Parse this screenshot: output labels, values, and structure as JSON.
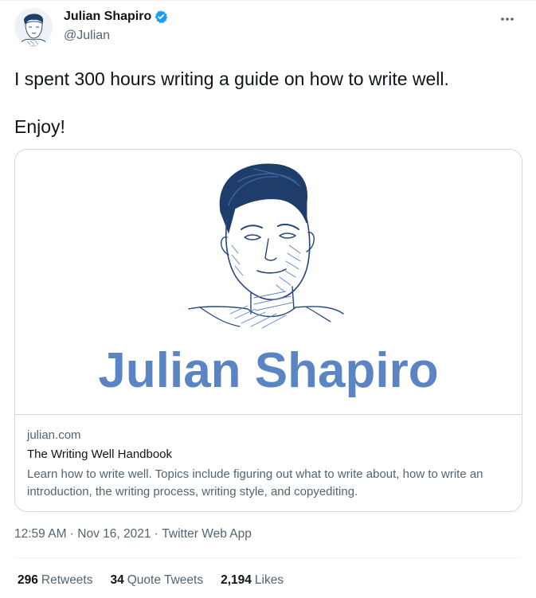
{
  "author": {
    "name": "Julian Shapiro",
    "handle": "@Julian",
    "verified_color": "#1d9bf0",
    "avatar_icon": "person-sketch-avatar"
  },
  "tweet": {
    "lines": [
      "I spent 300 hours writing a guide on how to write well.",
      "Enjoy!"
    ]
  },
  "card": {
    "image_text": "Julian Shapiro",
    "image_text_color": "#5b84c4",
    "domain": "julian.com",
    "title": "The Writing Well Handbook",
    "description": "Learn how to write well. Topics include figuring out what to write about, how to write an introduction, the writing process, writing style, and copyediting."
  },
  "meta": {
    "time": "12:59 AM",
    "date": "Nov 16, 2021",
    "source": "Twitter Web App"
  },
  "stats": {
    "retweets_count": "296",
    "retweets_label": "Retweets",
    "quotes_count": "34",
    "quotes_label": "Quote Tweets",
    "likes_count": "2,194",
    "likes_label": "Likes"
  }
}
